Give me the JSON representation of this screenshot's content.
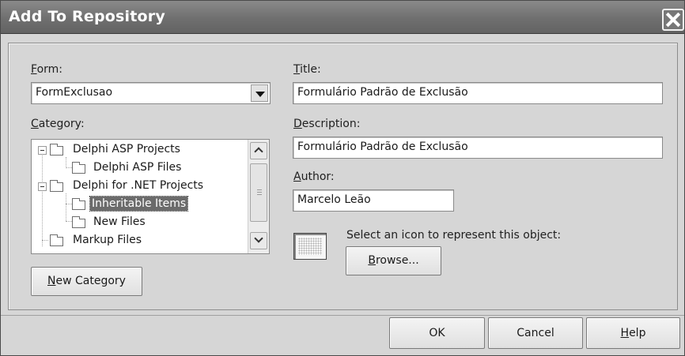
{
  "window": {
    "title": "Add To Repository"
  },
  "form": {
    "label_key": "F",
    "label_rest": "orm:",
    "value": "FormExclusao"
  },
  "category": {
    "label_key": "C",
    "label_rest": "ategory:",
    "items": [
      {
        "label": "Delphi ASP Projects",
        "expanded": true
      },
      {
        "label": "Delphi ASP Files"
      },
      {
        "label": "Delphi for .NET Projects",
        "expanded": true
      },
      {
        "label": "Inheritable Items",
        "selected": true
      },
      {
        "label": "New Files"
      },
      {
        "label": "Markup Files"
      }
    ]
  },
  "new_category_button": {
    "key": "N",
    "rest": "ew Category"
  },
  "title_field": {
    "label_key": "T",
    "label_rest": "itle:",
    "value": "Formulário Padrão de Exclusão"
  },
  "description_field": {
    "label_key": "D",
    "label_rest": "escription:",
    "value": "Formulário Padrão de Exclusão"
  },
  "author_field": {
    "label_key": "A",
    "label_rest": "uthor:",
    "value": "Marcelo Leão"
  },
  "icon_section": {
    "prompt": "Select an icon to represent this object:",
    "browse_key": "B",
    "browse_rest": "rowse..."
  },
  "buttons": {
    "ok": "OK",
    "cancel": "Cancel",
    "help_key": "H",
    "help_rest": "elp"
  },
  "colors": {
    "titlebar": "#6f6f6f",
    "dialog_bg": "#d6d6d6",
    "selection_bg": "#6b6b6b"
  }
}
